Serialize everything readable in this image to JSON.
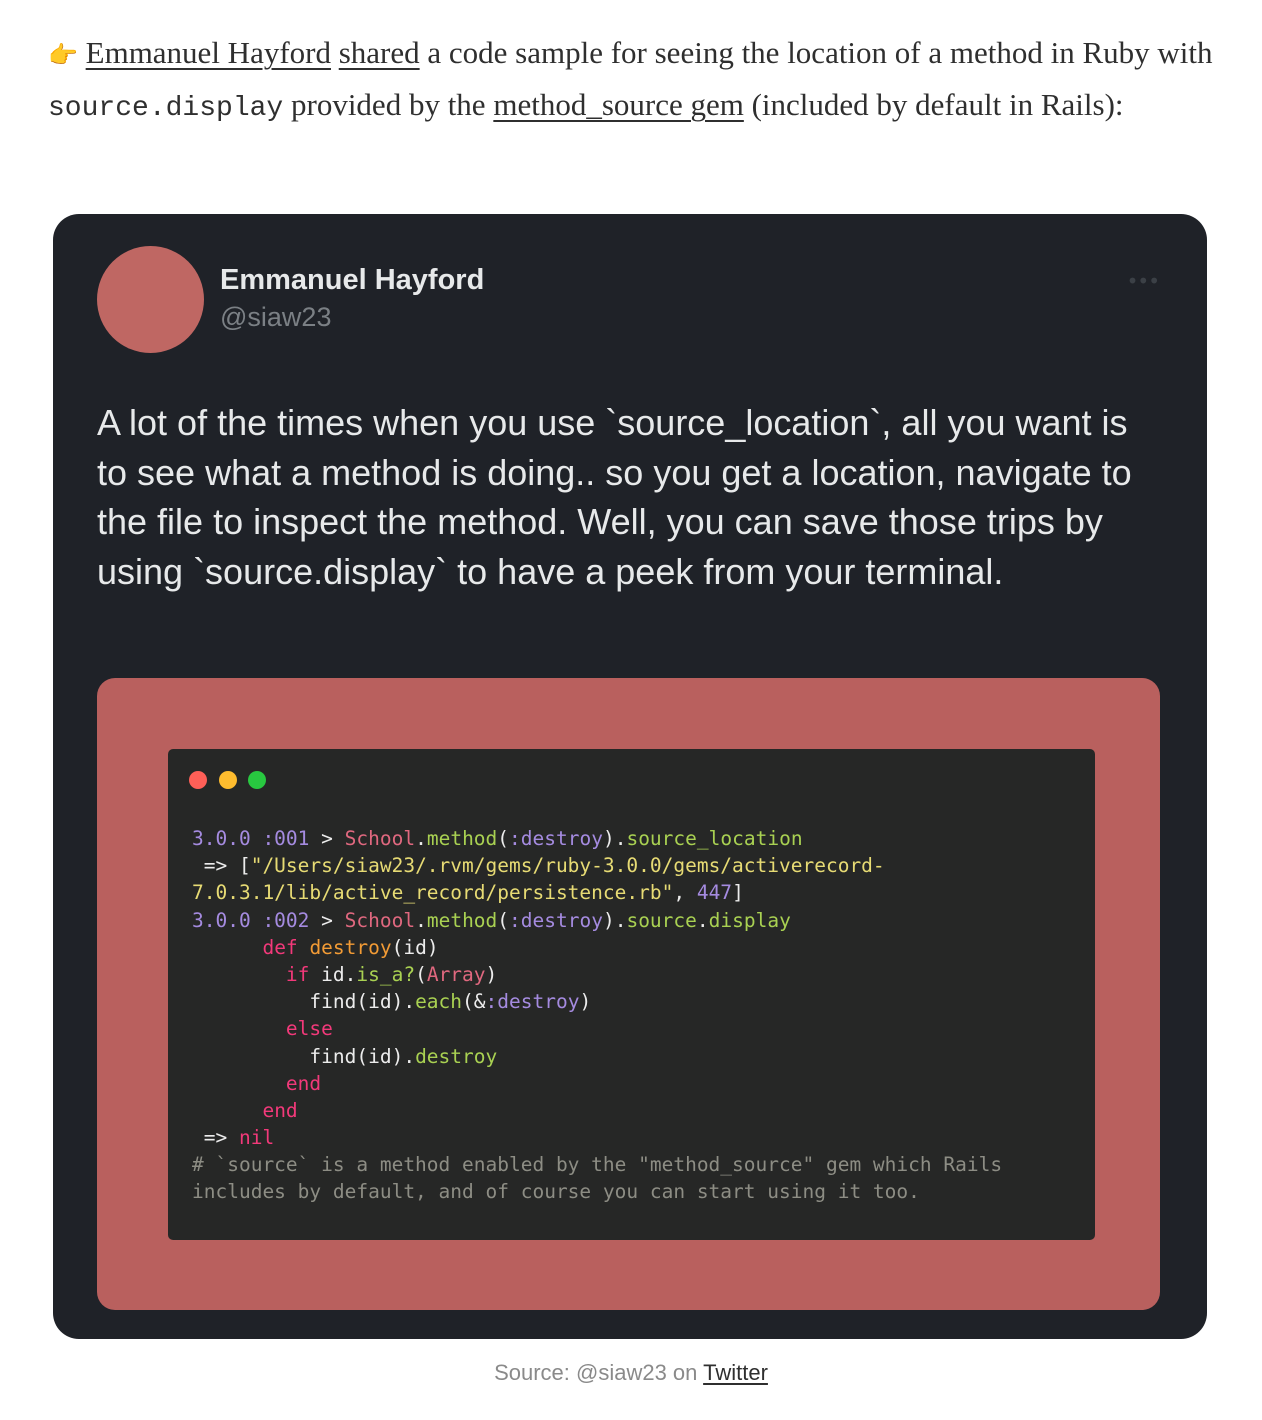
{
  "intro": {
    "pointer_emoji": "👉",
    "author_link": "Emmanuel Hayford",
    "shared_link": "shared",
    "text_1": " a code sample for seeing the location of a method in Ruby with ",
    "code": "source.display",
    "text_2": " provided by the ",
    "gem_link": "method_source gem",
    "text_3": " (included by default in Rails):"
  },
  "tweet": {
    "author_name": "Emmanuel Hayford",
    "author_handle": "@siaw23",
    "more_icon": "•••",
    "text": "A lot of the times when you use `source_location`, all you want is to see what a method is doing.. so you get a location, navigate to the file to inspect the method. Well, you can save those trips by using `source.display` to have a peek from your terminal.",
    "avatar_color": "#bf6763",
    "media_bg_color": "#b9605e"
  },
  "terminal": {
    "lines": [
      [
        [
          "3.0.0 :001",
          "num"
        ],
        [
          " > ",
          ""
        ],
        [
          "School",
          "const"
        ],
        [
          ".",
          ""
        ],
        [
          "method",
          "meth"
        ],
        [
          "(",
          ""
        ],
        [
          ":destroy",
          "num"
        ],
        [
          ").",
          ""
        ],
        [
          "source_location",
          "meth"
        ]
      ],
      [
        [
          " => [",
          ""
        ],
        [
          "\"/Users/siaw23/.rvm/gems/ruby-3.0.0/gems/activerecord-",
          "str"
        ]
      ],
      [
        [
          "7.0.3.1/lib/active_record/persistence.rb\"",
          "str"
        ],
        [
          ", ",
          ""
        ],
        [
          "447",
          "num"
        ],
        [
          "]",
          ""
        ]
      ],
      [
        [
          "3.0.0 :002",
          "num"
        ],
        [
          " > ",
          ""
        ],
        [
          "School",
          "const"
        ],
        [
          ".",
          ""
        ],
        [
          "method",
          "meth"
        ],
        [
          "(",
          ""
        ],
        [
          ":destroy",
          "num"
        ],
        [
          ").",
          ""
        ],
        [
          "source",
          "meth"
        ],
        [
          ".",
          ""
        ],
        [
          "display",
          "meth"
        ]
      ],
      [
        [
          "      ",
          ""
        ],
        [
          "def",
          "kw"
        ],
        [
          " ",
          ""
        ],
        [
          "destroy",
          "cls"
        ],
        [
          "(id)",
          ""
        ]
      ],
      [
        [
          "        ",
          ""
        ],
        [
          "if",
          "kw"
        ],
        [
          " id.",
          ""
        ],
        [
          "is_a?",
          "meth"
        ],
        [
          "(",
          ""
        ],
        [
          "Array",
          "const"
        ],
        [
          ")",
          ""
        ]
      ],
      [
        [
          "          find(id).",
          ""
        ],
        [
          "each",
          "meth"
        ],
        [
          "(&",
          ""
        ],
        [
          ":destroy",
          "num"
        ],
        [
          ")",
          ""
        ]
      ],
      [
        [
          "        ",
          ""
        ],
        [
          "else",
          "kw"
        ]
      ],
      [
        [
          "          find(id).",
          ""
        ],
        [
          "destroy",
          "meth"
        ]
      ],
      [
        [
          "        ",
          ""
        ],
        [
          "end",
          "kw"
        ]
      ],
      [
        [
          "      ",
          ""
        ],
        [
          "end",
          "kw"
        ]
      ],
      [
        [
          " => ",
          ""
        ],
        [
          "nil",
          "kw"
        ]
      ],
      [
        [
          "# `source` is a method enabled by the \"method_source\" gem which Rails",
          "cmt"
        ]
      ],
      [
        [
          "includes by default, and of course you can start using it too.",
          "cmt"
        ]
      ]
    ],
    "colors": {
      "num": "#a58be0",
      "const": "#e0687f",
      "meth": "#a9d152",
      "str": "#e7db74",
      "kw": "#f2397a",
      "cls": "#f29b35",
      "cmt": "#8d8d84"
    }
  },
  "caption": {
    "prefix": "Source: @siaw23 on ",
    "link": "Twitter"
  }
}
